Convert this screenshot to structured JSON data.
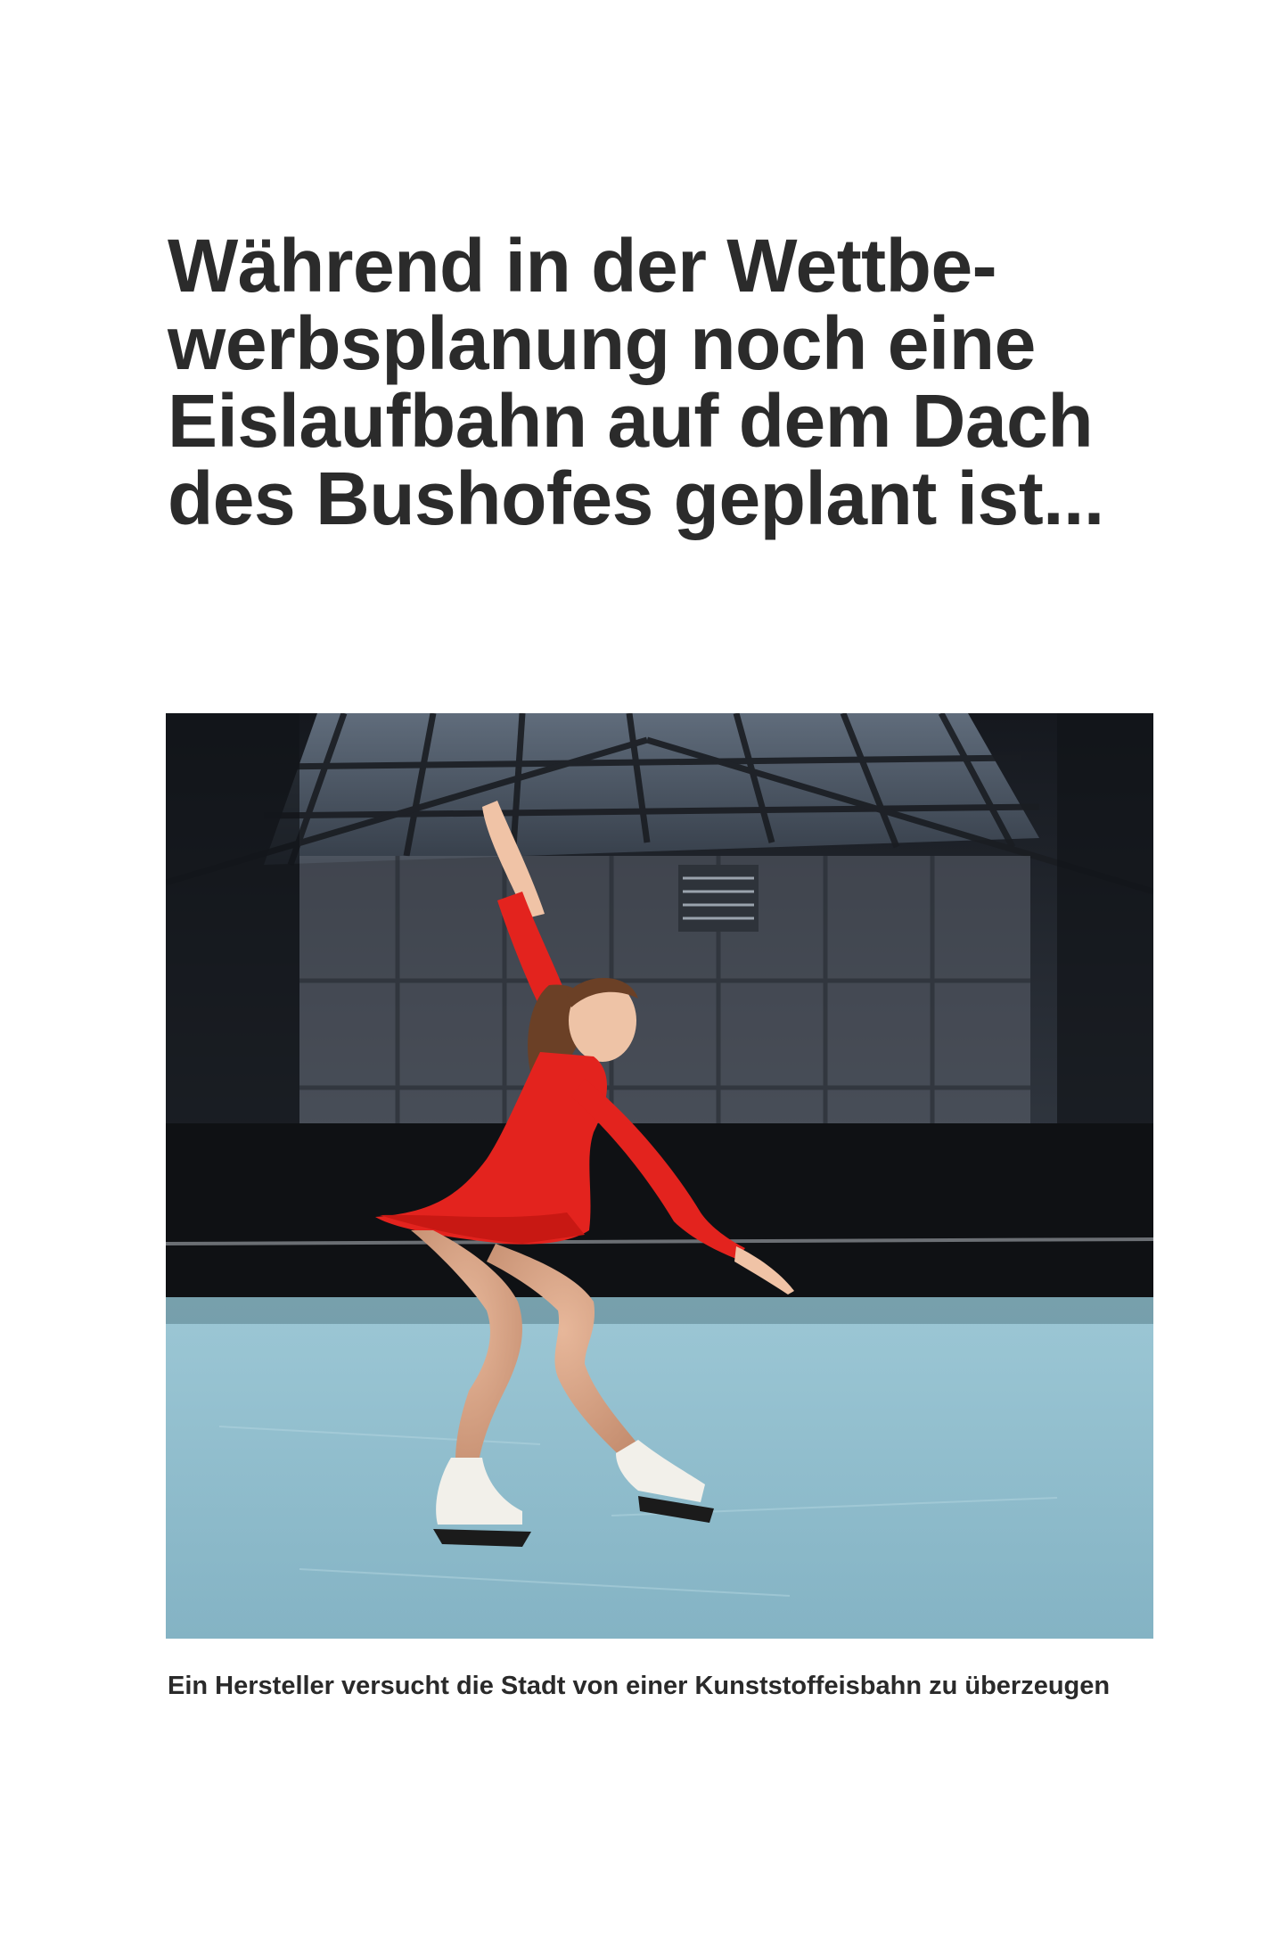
{
  "headline": {
    "lines": [
      "Während in der Wettbe-",
      "werbsplanung noch eine",
      "Eislaufbahn auf dem Dach",
      "des Bushofes geplant ist..."
    ]
  },
  "caption": "Ein Hersteller versucht die Stadt von einer Kunststoffeisbahn zu überzeugen",
  "photo": {
    "colors": {
      "dress": "#e3231e",
      "ice": "#8fbccb",
      "hall": "#2b3038",
      "skates": "#f2f0ea"
    }
  }
}
